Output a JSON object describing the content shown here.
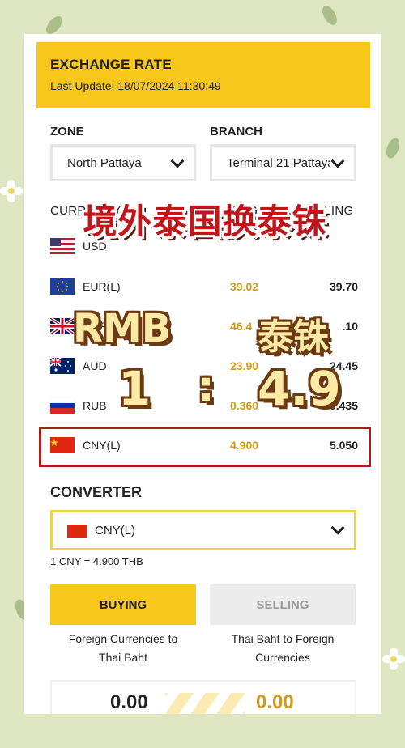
{
  "header": {
    "title": "EXCHANGE RATE",
    "last_update": "Last Update: 18/07/2024 11:30:49"
  },
  "filters": {
    "zone_label": "ZONE",
    "zone_value": "North Pattaya",
    "branch_label": "BRANCH",
    "branch_value": "Terminal 21 Pattaya"
  },
  "table": {
    "headers": {
      "currency": "CURRENCY",
      "buying": "BUYING",
      "selling": "SELLING"
    },
    "rows": [
      {
        "code": "USD",
        "buying": "",
        "selling": "",
        "flag": "us-flag-icon"
      },
      {
        "code": "EUR(L)",
        "buying": "39.02",
        "selling": "39.70",
        "flag": "eu-flag-icon"
      },
      {
        "code": "GBP",
        "buying": "46.4",
        "selling": ".10",
        "flag": "uk-flag-icon"
      },
      {
        "code": "AUD",
        "buying": "23.90",
        "selling": "24.45",
        "flag": "au-flag-icon"
      },
      {
        "code": "RUB",
        "buying": "0.360",
        "selling": "0.435",
        "flag": "ru-flag-icon"
      },
      {
        "code": "CNY(L)",
        "buying": "4.900",
        "selling": "5.050",
        "flag": "cn-flag-icon"
      }
    ]
  },
  "converter": {
    "title": "CONVERTER",
    "selected": "CNY(L)",
    "rate_line": "1 CNY = 4.900 THB",
    "buying_label": "BUYING",
    "selling_label": "SELLING",
    "buying_desc_1": "Foreign Currencies to",
    "buying_desc_2": "Thai Baht",
    "selling_desc_1": "Thai Baht to Foreign",
    "selling_desc_2": "Currencies",
    "amount_from": "0.00",
    "amount_to": "0.00"
  },
  "overlay": {
    "title": "境外泰国换泰铢",
    "rmb": "RMB",
    "thb": "泰铢",
    "one": "1",
    "colon": ":",
    "ratio": "4.9"
  },
  "colors": {
    "accent": "#f7c71b",
    "highlight_border": "#a3201a",
    "buy_value": "#d49a15"
  }
}
